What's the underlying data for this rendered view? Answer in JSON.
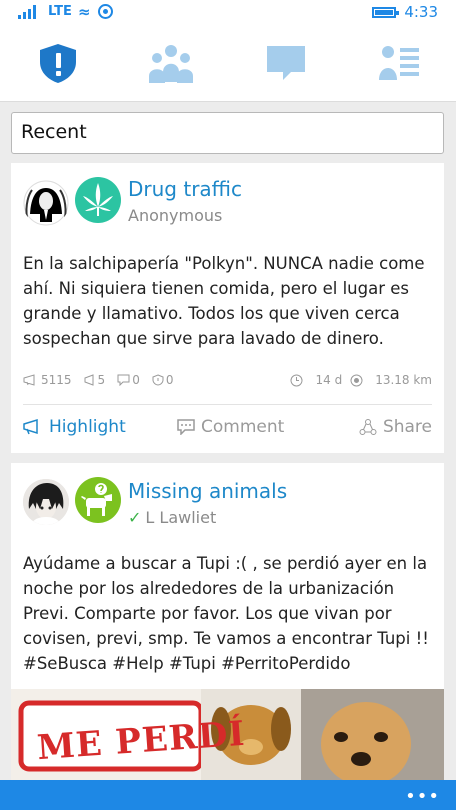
{
  "status_bar": {
    "network": "LTE",
    "time": "4:33"
  },
  "nav": {
    "tabs": [
      {
        "icon": "shield-alert-icon",
        "active": true
      },
      {
        "icon": "community-icon",
        "active": false
      },
      {
        "icon": "chat-icon",
        "active": false
      },
      {
        "icon": "profile-list-icon",
        "active": false
      }
    ]
  },
  "filter": {
    "selected": "Recent"
  },
  "posts": [
    {
      "category": "Drug traffic",
      "category_icon": "cannabis-leaf-icon",
      "category_color": "#2cc4a2",
      "author": "Anonymous",
      "verified": false,
      "body": "En la salchipapería \"Polkyn\". NUNCA nadie come ahí. Ni siquiera tienen comida, pero el lugar es grande y llamativo. Todos los que viven cerca sospechan que sirve para lavado de dinero.",
      "stats": {
        "views": "5115",
        "highlights": "5",
        "comments": "0",
        "alerts": "0"
      },
      "age": "14 d",
      "distance": "13.18 km",
      "actions": {
        "highlight": "Highlight",
        "comment": "Comment",
        "share": "Share"
      }
    },
    {
      "category": "Missing animals",
      "category_icon": "dog-help-icon",
      "category_color": "#7cc21f",
      "author": "L Lawliet",
      "verified": true,
      "body": "Ayúdame a buscar a Tupi :( , se perdió ayer en la noche por los alrededores de la urbanización Previ. Comparte por favor. Los que vivan por covisen, previ, smp. Te vamos a encontrar Tupi !! #SeBusca #Help #Tupi #PerritoPerdido",
      "image_text": "ME PERDÍ"
    }
  ],
  "app_bar": {
    "more_label": "•••"
  },
  "colors": {
    "accent": "#1e88e5",
    "link": "#1e88c9",
    "muted": "#9a9a9a"
  }
}
